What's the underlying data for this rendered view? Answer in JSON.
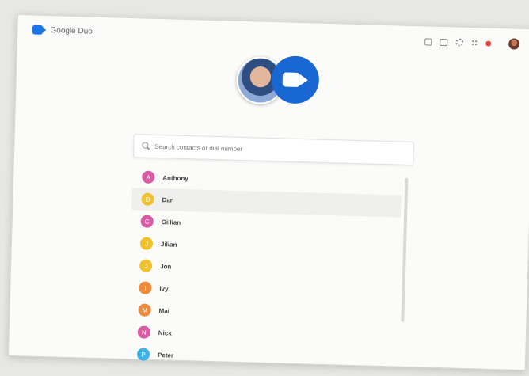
{
  "app": {
    "title": "Google Duo"
  },
  "topbar": {
    "icons": [
      "tv-icon",
      "chat-icon",
      "settings-icon",
      "apps-icon",
      "notification-icon",
      "account-avatar-icon"
    ]
  },
  "search": {
    "placeholder": "Search contacts or dial number"
  },
  "contacts": [
    {
      "name": "Anthony",
      "initial": "A",
      "color": "#d85ba3",
      "time": ""
    },
    {
      "name": "Dan",
      "initial": "D",
      "color": "#f2c12e",
      "time": "",
      "highlight": true
    },
    {
      "name": "Gillian",
      "initial": "G",
      "color": "#d85ba3",
      "time": ""
    },
    {
      "name": "Jilian",
      "initial": "J",
      "color": "#f2c12e",
      "time": ""
    },
    {
      "name": "Jon",
      "initial": "J",
      "color": "#f2c12e",
      "time": ""
    },
    {
      "name": "Ivy",
      "initial": "I",
      "color": "#ef8a3a",
      "time": ""
    },
    {
      "name": "Mai",
      "initial": "M",
      "color": "#ef8a3a",
      "time": ""
    },
    {
      "name": "Nick",
      "initial": "N",
      "color": "#d85ba3",
      "time": ""
    },
    {
      "name": "Peter",
      "initial": "P",
      "color": "#3fb3e5",
      "time": ""
    }
  ]
}
